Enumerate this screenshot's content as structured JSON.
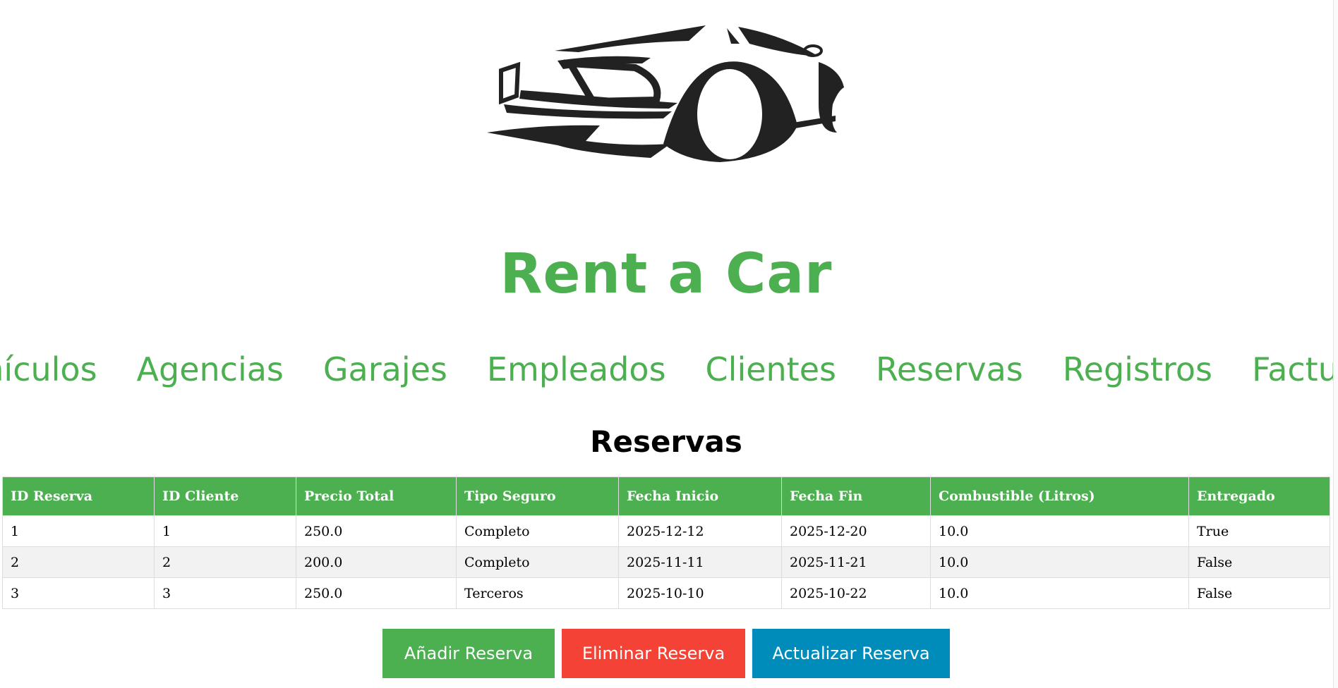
{
  "app": {
    "title": "Rent a Car",
    "logo_icon": "car-silhouette-icon",
    "accent_color": "#4caf50"
  },
  "nav": {
    "items": [
      {
        "label": "Vehículos"
      },
      {
        "label": "Agencias"
      },
      {
        "label": "Garajes"
      },
      {
        "label": "Empleados"
      },
      {
        "label": "Clientes"
      },
      {
        "label": "Reservas"
      },
      {
        "label": "Registros"
      },
      {
        "label": "Facturas"
      }
    ]
  },
  "section": {
    "title": "Reservas"
  },
  "table": {
    "headers": [
      "ID Reserva",
      "ID Cliente",
      "Precio Total",
      "Tipo Seguro",
      "Fecha Inicio",
      "Fecha Fin",
      "Combustible (Litros)",
      "Entregado"
    ],
    "rows": [
      [
        "1",
        "1",
        "250.0",
        "Completo",
        "2025-12-12",
        "2025-12-20",
        "10.0",
        "True"
      ],
      [
        "2",
        "2",
        "200.0",
        "Completo",
        "2025-11-11",
        "2025-11-21",
        "10.0",
        "False"
      ],
      [
        "3",
        "3",
        "250.0",
        "Terceros",
        "2025-10-10",
        "2025-10-22",
        "10.0",
        "False"
      ]
    ]
  },
  "buttons": {
    "add_label": "Añadir Reserva",
    "delete_label": "Eliminar Reserva",
    "update_label": "Actualizar Reserva",
    "add_color": "#4caf50",
    "delete_color": "#f44336",
    "update_color": "#008cba"
  }
}
